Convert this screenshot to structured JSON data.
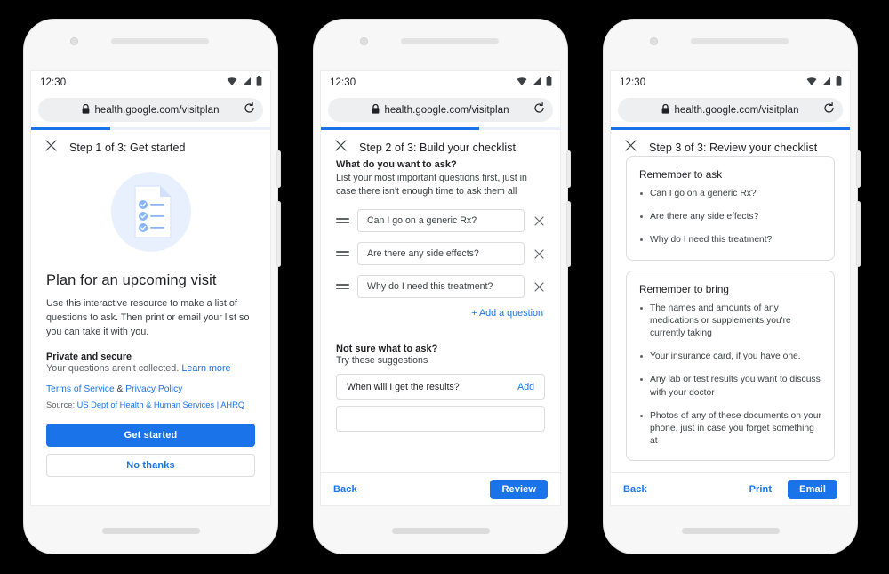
{
  "browser": {
    "status_time": "12:30",
    "url": "health.google.com/visitplan",
    "lock_icon": "lock-icon",
    "reload_icon": "reload-icon",
    "wifi_icon": "wifi-icon",
    "signal_icon": "cell-signal-icon",
    "battery_icon": "battery-icon"
  },
  "colors": {
    "accent": "#1a73e8",
    "text_primary": "#202124",
    "text_secondary": "#3c4043",
    "text_muted": "#5f6368",
    "border": "#dadce0",
    "illustration_light": "#e8f0fe",
    "illustration_blue": "#8ab4f8"
  },
  "screens": [
    {
      "id": "step-1",
      "close_label": "close-icon",
      "step_title": "Step 1 of 3:  Get started",
      "progress_percent": 33,
      "illustration": "checklist-document-icon",
      "heading": "Plan for an upcoming visit",
      "intro": "Use this interactive resource to make a list of questions to ask. Then print or email your list so you can take it with you.",
      "privacy_title": "Private and secure",
      "privacy_text": "Your questions aren't collected. ",
      "privacy_link": "Learn more",
      "terms_link": "Terms of Service",
      "terms_amp": " & ",
      "privacy_policy_link": "Privacy Policy",
      "source_prefix": "Source: ",
      "source_link": "US Dept of Health & Human Services | AHRQ",
      "primary_button": "Get started",
      "secondary_button": "No thanks"
    },
    {
      "id": "step-2",
      "close_label": "close-icon",
      "step_title": "Step 2 of 3:  Build your checklist",
      "progress_percent": 66,
      "question_label": "What do you want to ask?",
      "question_sub": "List your most important questions first, just in case there isn't enough time to ask them all",
      "questions": [
        "Can I go on a generic Rx?",
        "Are there any side effects?",
        "Why do I need this treatment?"
      ],
      "add_question": "+  Add a question",
      "not_sure_title": "Not sure what to ask?",
      "not_sure_sub": "Try these suggestions",
      "suggestions": [
        {
          "text": "When will I get the results?",
          "action": "Add"
        }
      ],
      "back_button": "Back",
      "review_button": "Review"
    },
    {
      "id": "step-3",
      "close_label": "close-icon",
      "step_title": "Step 3 of 3:  Review your checklist",
      "progress_percent": 100,
      "cards": [
        {
          "title": "Remember to ask",
          "items": [
            "Can I go on a generic Rx?",
            "Are there any side effects?",
            "Why do I need this treatment?"
          ]
        },
        {
          "title": "Remember to bring",
          "items": [
            "The names and amounts of any medications or supplements you're currently taking",
            "Your insurance card, if you have one.",
            "Any lab or test results you want to discuss with your doctor",
            "Photos of any of these documents on your phone, just in case you forget something at"
          ]
        }
      ],
      "back_button": "Back",
      "print_button": "Print",
      "email_button": "Email"
    }
  ]
}
